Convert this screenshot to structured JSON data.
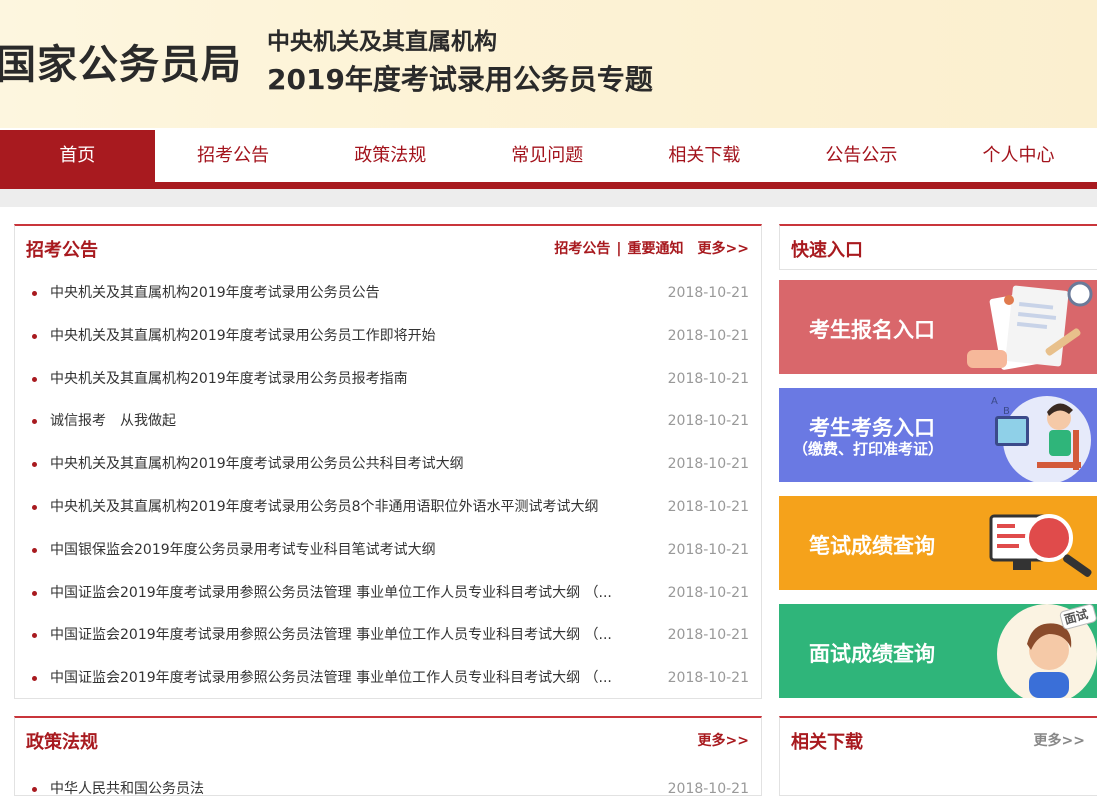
{
  "header": {
    "logo": "国家公务员局",
    "subtitle": "中央机关及其直属机构",
    "title": "2019年度考试录用公务员专题"
  },
  "nav": {
    "items": [
      "首页",
      "招考公告",
      "政策法规",
      "常见问题",
      "相关下载",
      "公告公示",
      "个人中心"
    ],
    "active": "首页"
  },
  "announcements": {
    "title": "招考公告",
    "links": [
      "招考公告",
      "重要通知"
    ],
    "separator": "|",
    "more": "更多>>",
    "items": [
      {
        "text": "中央机关及其直属机构2019年度考试录用公务员公告",
        "date": "2018-10-21"
      },
      {
        "text": "中央机关及其直属机构2019年度考试录用公务员工作即将开始",
        "date": "2018-10-21"
      },
      {
        "text": "中央机关及其直属机构2019年度考试录用公务员报考指南",
        "date": "2018-10-21"
      },
      {
        "text": "诚信报考　从我做起",
        "date": "2018-10-21"
      },
      {
        "text": "中央机关及其直属机构2019年度考试录用公务员公共科目考试大纲",
        "date": "2018-10-21"
      },
      {
        "text": "中央机关及其直属机构2019年度考试录用公务员8个非通用语职位外语水平测试考试大纲",
        "date": "2018-10-21"
      },
      {
        "text": "中国银保监会2019年度公务员录用考试专业科目笔试考试大纲",
        "date": "2018-10-21"
      },
      {
        "text": "中国证监会2019年度考试录用参照公务员法管理 事业单位工作人员专业科目考试大纲 （...",
        "date": "2018-10-21"
      },
      {
        "text": "中国证监会2019年度考试录用参照公务员法管理 事业单位工作人员专业科目考试大纲 （...",
        "date": "2018-10-21"
      },
      {
        "text": "中国证监会2019年度考试录用参照公务员法管理 事业单位工作人员专业科目考试大纲 （...",
        "date": "2018-10-21"
      }
    ]
  },
  "quick_entry": {
    "title": "快速入口",
    "items": [
      {
        "label": "考生报名入口",
        "sublabel": "",
        "color": "#d9676b"
      },
      {
        "label": "考生考务入口",
        "sublabel": "（缴费、打印准考证）",
        "color": "#6a79e3"
      },
      {
        "label": "笔试成绩查询",
        "sublabel": "",
        "color": "#f5a21b"
      },
      {
        "label": "面试成绩查询",
        "sublabel": "",
        "color": "#2fb57a"
      }
    ],
    "badge": "面试"
  },
  "policy": {
    "title": "政策法规",
    "more": "更多>>",
    "first_item": {
      "text": "中华人民共和国公务员法",
      "date": "2018-10-21"
    }
  },
  "downloads": {
    "title": "相关下载",
    "more": "更多>>"
  },
  "colors": {
    "brand_red": "#a81a1f",
    "header_bg": "#fdf3d6"
  }
}
